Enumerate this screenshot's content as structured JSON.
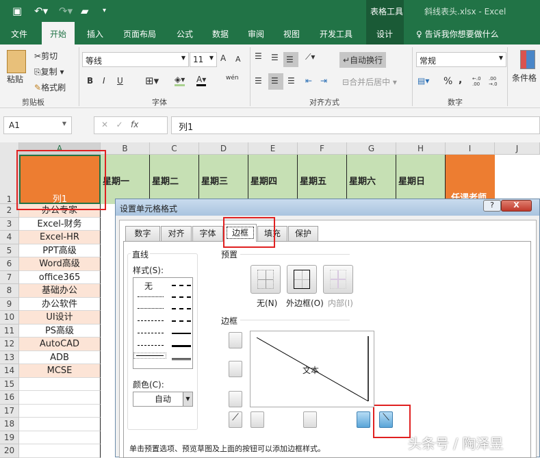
{
  "titlebar": {
    "context_tab": "表格工具",
    "title": "斜线表头.xlsx  -  Excel",
    "icons": [
      "save-icon",
      "undo-icon",
      "redo-icon",
      "open-folder-icon",
      "customize-icon"
    ]
  },
  "tabs": [
    {
      "label": "文件"
    },
    {
      "label": "开始",
      "active": true
    },
    {
      "label": "插入"
    },
    {
      "label": "页面布局"
    },
    {
      "label": "公式"
    },
    {
      "label": "数据"
    },
    {
      "label": "审阅"
    },
    {
      "label": "视图"
    },
    {
      "label": "开发工具"
    },
    {
      "label": "设计"
    }
  ],
  "tell_me": "告诉我你想要做什么",
  "ribbon": {
    "clipboard": {
      "paste": "粘贴",
      "cut": "剪切",
      "copy": "复制",
      "format_painter": "格式刷",
      "group": "剪贴板"
    },
    "font": {
      "name": "等线",
      "size": "11",
      "bold": "B",
      "italic": "I",
      "underline": "U",
      "phonetic": "wén",
      "group": "字体"
    },
    "alignment": {
      "wrap": "自动换行",
      "merge": "合并后居中",
      "group": "对齐方式"
    },
    "number": {
      "format": "常规",
      "percent": "%",
      "comma": ",",
      "inc_decimal": "←.0 .00",
      "dec_decimal": ".00 →.0",
      "group": "数字"
    },
    "styles": {
      "conditional": "条件格"
    }
  },
  "formula_bar": {
    "name_box": "A1",
    "fx": "fx",
    "value": "列1"
  },
  "sheet": {
    "columns": [
      "A",
      "B",
      "C",
      "D",
      "E",
      "F",
      "G",
      "H",
      "I",
      "J"
    ],
    "rows": [
      "1",
      "2",
      "3",
      "4",
      "5",
      "6",
      "7",
      "8",
      "9",
      "10",
      "11",
      "12",
      "13",
      "14",
      "15",
      "16",
      "17",
      "18",
      "19",
      "20"
    ],
    "a1": "列1",
    "days": [
      "星期一",
      "星期二",
      "星期三",
      "星期四",
      "星期五",
      "星期六",
      "星期日"
    ],
    "i1": "任课老师",
    "col_a": [
      "办公专家",
      "Excel-财务",
      "Excel-HR",
      "PPT高级",
      "Word高级",
      "office365",
      "基础办公",
      "办公软件",
      "UI设计",
      "PS高级",
      "AutoCAD",
      "ADB",
      "MCSE"
    ],
    "colors": {
      "header_orange": "#ed7d31",
      "day_green": "#c6e0b4",
      "row_tint": "#fce4d6",
      "excel_green": "#217346"
    }
  },
  "dialog": {
    "title": "设置单元格格式",
    "help": "?",
    "close": "X",
    "tabs": [
      {
        "label": "数字"
      },
      {
        "label": "对齐"
      },
      {
        "label": "字体"
      },
      {
        "label": "边框",
        "active": true
      },
      {
        "label": "填充"
      },
      {
        "label": "保护"
      }
    ],
    "line": {
      "label": "直线",
      "style_label": "样式(S):",
      "none": "无",
      "color_label": "颜色(C):",
      "color_value": "自动"
    },
    "presets": {
      "label": "预置",
      "none": "无(N)",
      "outline": "外边框(O)",
      "inside": "内部(I)"
    },
    "border": {
      "label": "边框",
      "preview_text": "文本"
    },
    "hint": "单击预置选项、预览草图及上面的按钮可以添加边框样式。"
  },
  "watermark": "头条号 / 陶泽昱"
}
